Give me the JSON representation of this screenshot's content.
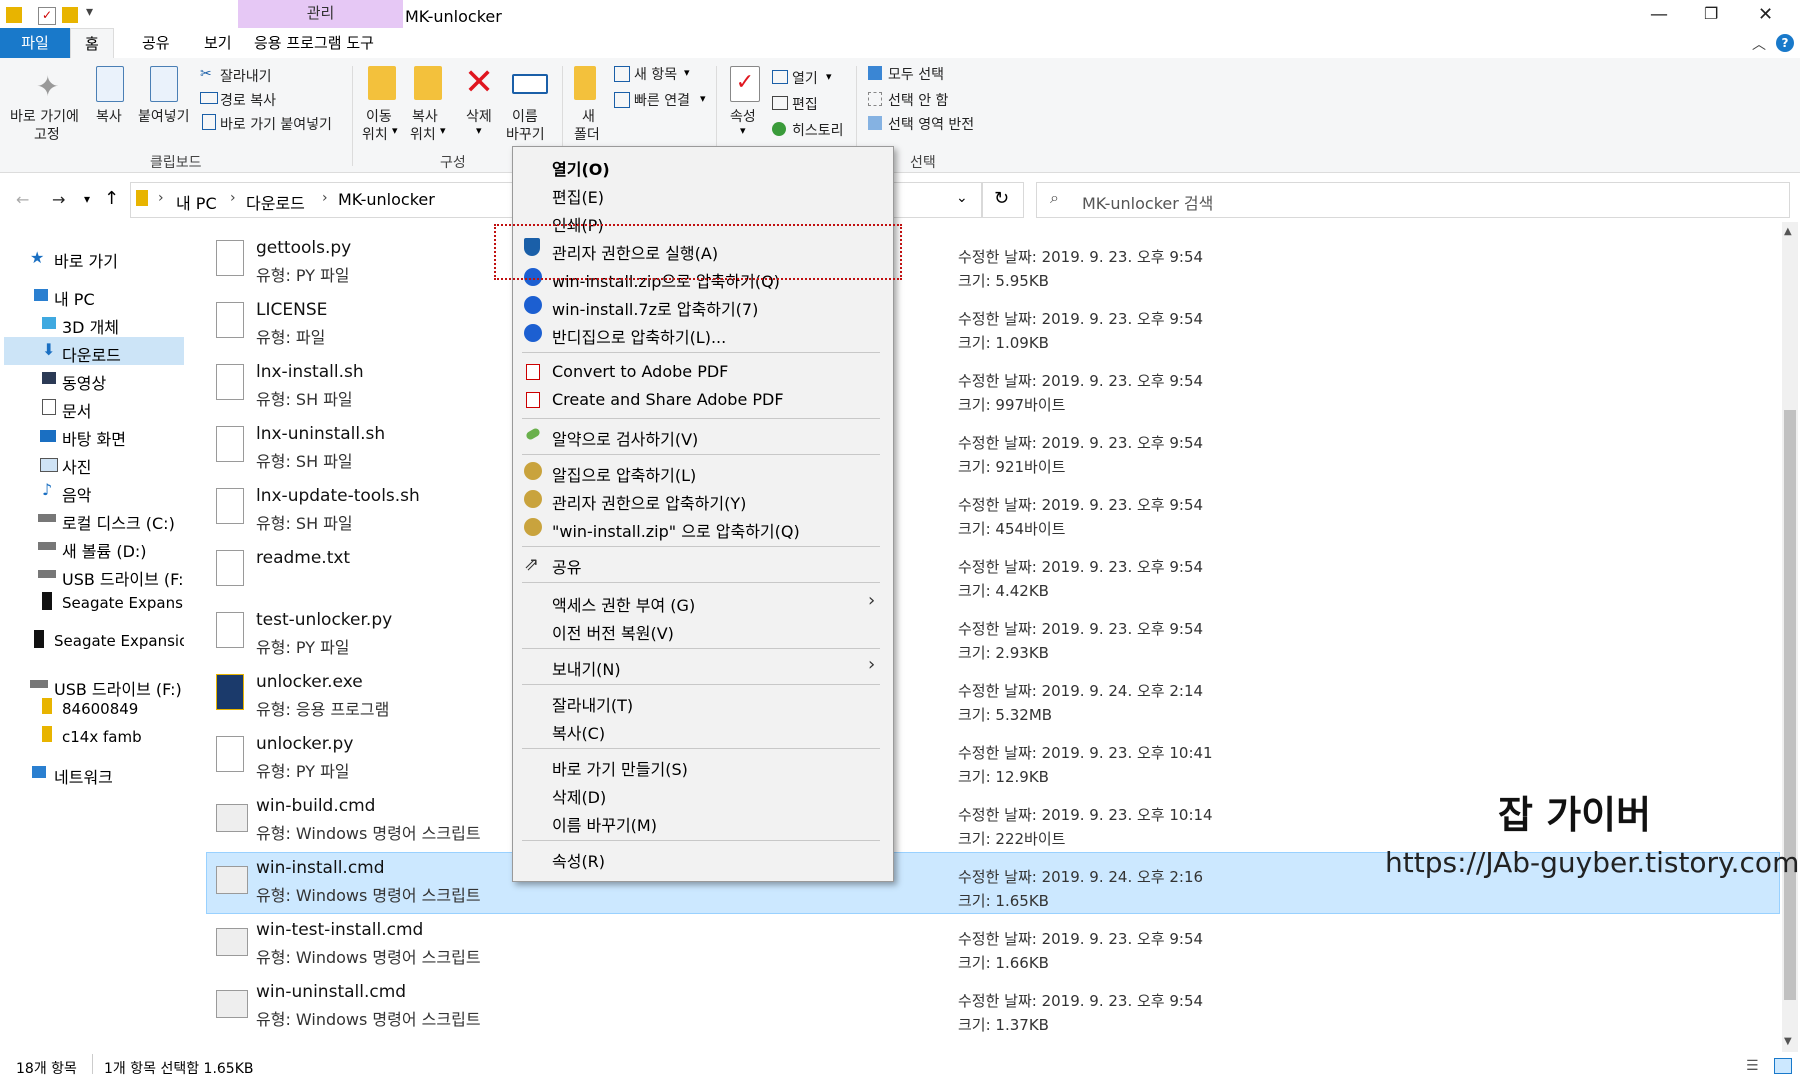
{
  "window": {
    "title": "MK-unlocker",
    "management_tab": "관리"
  },
  "ribbon_tabs": [
    "파일",
    "홈",
    "공유",
    "보기",
    "응용 프로그램 도구"
  ],
  "ribbon": {
    "clipboard": {
      "pin_label_1": "바로 가기에",
      "pin_label_2": "고정",
      "copy": "복사",
      "paste": "붙여넣기",
      "cut": "잘라내기",
      "copy_path": "경로 복사",
      "paste_shortcut": "바로 가기 붙여넣기",
      "group": "클립보드"
    },
    "organize": {
      "move_1": "이동",
      "move_2": "위치",
      "copyto_1": "복사",
      "copyto_2": "위치",
      "delete": "삭제",
      "rename_1": "이름",
      "rename_2": "바꾸기",
      "group": "구성"
    },
    "new": {
      "folder_1": "새",
      "folder_2": "폴더",
      "new_item": "새 항목",
      "easy_access": "빠른 연결"
    },
    "open": {
      "properties": "속성",
      "open": "열기",
      "edit": "편집",
      "history": "히스토리"
    },
    "select": {
      "select_all": "모두 선택",
      "select_none": "선택 안 함",
      "invert": "선택 영역 반전",
      "group": "선택"
    }
  },
  "address": {
    "crumbs": [
      "내 PC",
      "다운로드",
      "MK-unlocker"
    ],
    "search_placeholder": "MK-unlocker 검색"
  },
  "nav": {
    "quick_access": "바로 가기",
    "this_pc": "내 PC",
    "objects3d": "3D 개체",
    "downloads": "다운로드",
    "videos": "동영상",
    "documents": "문서",
    "desktop": "바탕 화면",
    "pictures": "사진",
    "music": "음악",
    "local_c": "로컬 디스크 (C:)",
    "vol_d": "새 볼륨 (D:)",
    "usb_f": "USB 드라이브 (F:)",
    "seagate1": "Seagate Expansio",
    "seagate2": "Seagate Expansior",
    "usb_f2": "USB 드라이브 (F:)",
    "folder1": "84600849",
    "folder2": "c14x famb",
    "network": "네트워크"
  },
  "files": [
    {
      "name": "gettools.py",
      "type": "유형: PY 파일",
      "date": "수정한 날짜: 2019. 9. 23. 오후 9:54",
      "size": "크기: 5.95KB"
    },
    {
      "name": "LICENSE",
      "type": "유형: 파일",
      "date": "수정한 날짜: 2019. 9. 23. 오후 9:54",
      "size": "크기: 1.09KB"
    },
    {
      "name": "lnx-install.sh",
      "type": "유형: SH 파일",
      "date": "수정한 날짜: 2019. 9. 23. 오후 9:54",
      "size": "크기: 997바이트"
    },
    {
      "name": "lnx-uninstall.sh",
      "type": "유형: SH 파일",
      "date": "수정한 날짜: 2019. 9. 23. 오후 9:54",
      "size": "크기: 921바이트"
    },
    {
      "name": "lnx-update-tools.sh",
      "type": "유형: SH 파일",
      "date": "수정한 날짜: 2019. 9. 23. 오후 9:54",
      "size": "크기: 454바이트"
    },
    {
      "name": "readme.txt",
      "type": "",
      "date": "수정한 날짜: 2019. 9. 23. 오후 9:54",
      "size": "크기: 4.42KB"
    },
    {
      "name": "test-unlocker.py",
      "type": "유형: PY 파일",
      "date": "수정한 날짜: 2019. 9. 23. 오후 9:54",
      "size": "크기: 2.93KB"
    },
    {
      "name": "unlocker.exe",
      "type": "유형: 응용 프로그램",
      "date": "수정한 날짜: 2019. 9. 24. 오후 2:14",
      "size": "크기: 5.32MB"
    },
    {
      "name": "unlocker.py",
      "type": "유형: PY 파일",
      "date": "수정한 날짜: 2019. 9. 23. 오후 10:41",
      "size": "크기: 12.9KB"
    },
    {
      "name": "win-build.cmd",
      "type": "유형: Windows 명령어 스크립트",
      "date": "수정한 날짜: 2019. 9. 23. 오후 10:14",
      "size": "크기: 222바이트"
    },
    {
      "name": "win-install.cmd",
      "type": "유형: Windows 명령어 스크립트",
      "date": "수정한 날짜: 2019. 9. 24. 오후 2:16",
      "size": "크기: 1.65KB"
    },
    {
      "name": "win-test-install.cmd",
      "type": "유형: Windows 명령어 스크립트",
      "date": "수정한 날짜: 2019. 9. 23. 오후 9:54",
      "size": "크기: 1.66KB"
    },
    {
      "name": "win-uninstall.cmd",
      "type": "유형: Windows 명령어 스크립트",
      "date": "수정한 날짜: 2019. 9. 23. 오후 9:54",
      "size": "크기: 1.37KB"
    }
  ],
  "context_menu": {
    "open": "열기(O)",
    "edit": "편집(E)",
    "print": "인쇄(P)",
    "run_as_admin": "관리자 권한으로 실행(A)",
    "zip_bz": "win-install.zip으로 압축하기(Q)",
    "sevenz": "win-install.7z로 압축하기(7)",
    "bandizip": "반디집으로 압축하기(L)...",
    "convert_pdf": "Convert to Adobe PDF",
    "share_pdf": "Create and Share Adobe PDF",
    "scan": "알약으로 검사하기(V)",
    "alzip": "알집으로 압축하기(L)",
    "alzip_admin": "관리자 권한으로 압축하기(Y)",
    "alzip_zip": "\"win-install.zip\" 으로 압축하기(Q)",
    "share": "공유",
    "give_access": "액세스 권한 부여 (G)",
    "restore": "이전 버전 복원(V)",
    "send_to": "보내기(N)",
    "cut": "잘라내기(T)",
    "copy": "복사(C)",
    "shortcut": "바로 가기 만들기(S)",
    "delete": "삭제(D)",
    "rename": "이름 바꾸기(M)",
    "properties": "속성(R)"
  },
  "status": {
    "count": "18개 항목",
    "selected": "1개 항목 선택함 1.65KB"
  },
  "watermark": {
    "title": "잡 가이버",
    "url": "https://JAb-guyber.tistory.com"
  },
  "colors": {
    "accent": "#1979ca",
    "selection": "#cce8ff",
    "management": "#e6c8f5"
  }
}
